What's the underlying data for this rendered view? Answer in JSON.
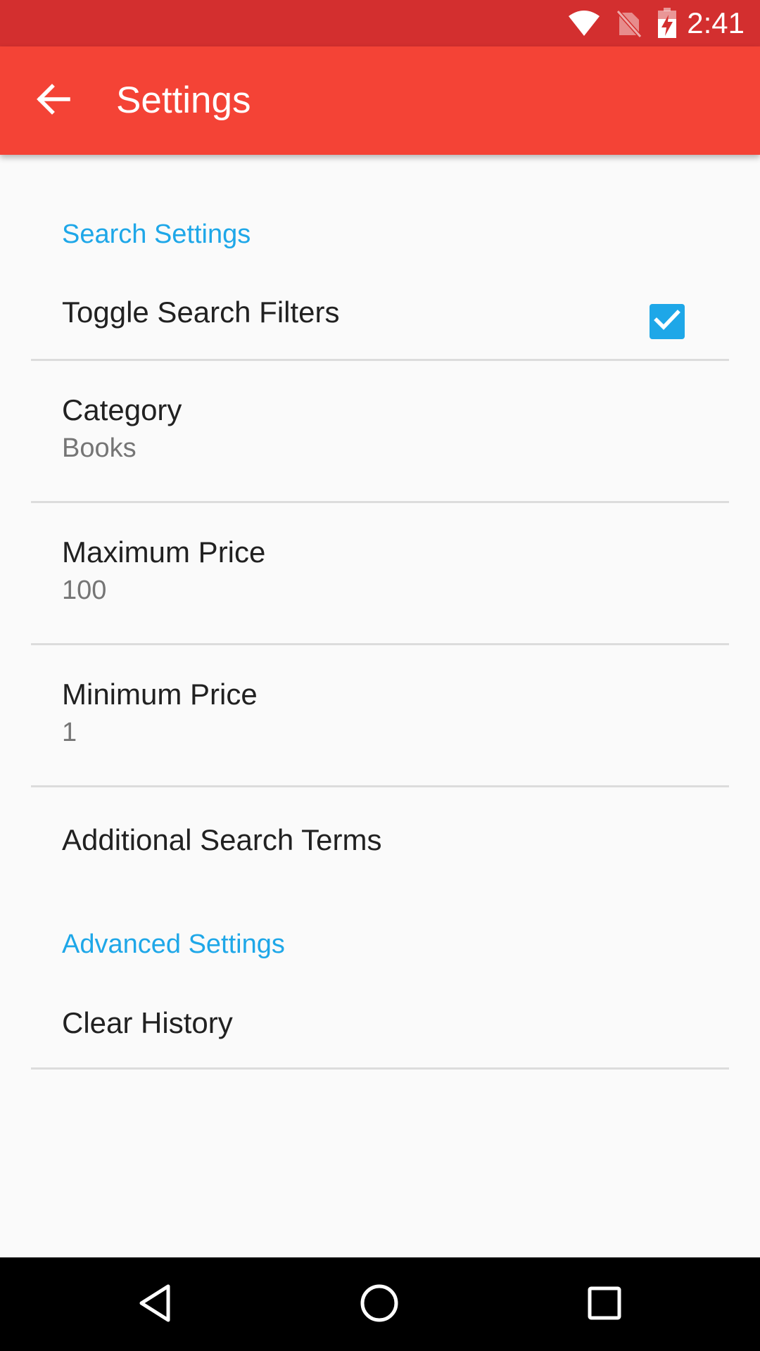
{
  "status_bar": {
    "time": "2:41",
    "color": "#d32f2f",
    "icons": [
      "wifi-icon",
      "no-sim-icon",
      "battery-charging-icon"
    ]
  },
  "app_bar": {
    "title": "Settings",
    "color": "#f44336",
    "back_icon": "arrow-back-icon"
  },
  "sections": {
    "search": {
      "header": "Search Settings",
      "toggle_filters": {
        "title": "Toggle Search Filters",
        "checked": true
      },
      "category": {
        "title": "Category",
        "summary": "Books"
      },
      "max_price": {
        "title": "Maximum Price",
        "summary": "100"
      },
      "min_price": {
        "title": "Minimum Price",
        "summary": "1"
      },
      "additional_terms": {
        "title": "Additional Search Terms"
      }
    },
    "advanced": {
      "header": "Advanced Settings",
      "clear_history": {
        "title": "Clear History"
      }
    }
  },
  "accent_color": "#1ea7e8",
  "nav_bar": {
    "icons": [
      "back-triangle-icon",
      "home-circle-icon",
      "recents-square-icon"
    ]
  }
}
